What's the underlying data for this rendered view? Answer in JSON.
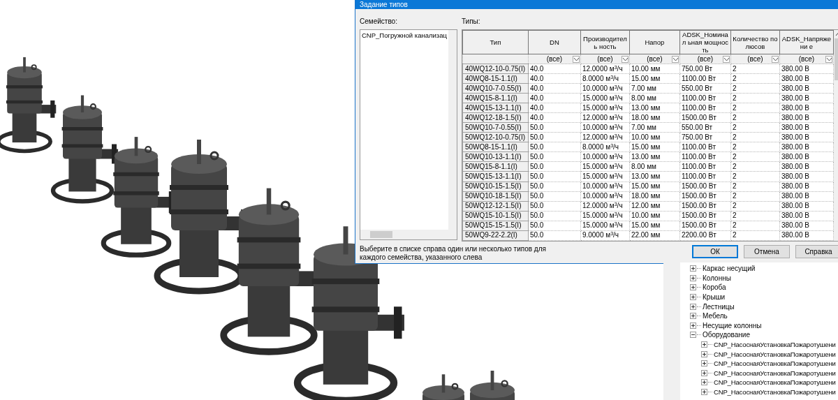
{
  "window": {
    "title": "Задание типов"
  },
  "family": {
    "label": "Семейство:",
    "items": [
      {
        "label": "CNP_Погружной канализац"
      }
    ]
  },
  "types": {
    "label": "Типы:",
    "columns": [
      {
        "title": "Тип"
      },
      {
        "title": "DN",
        "filter": "(все)"
      },
      {
        "title": "Производитель ность",
        "filter": "(все)"
      },
      {
        "title": "Напор",
        "filter": "(все)"
      },
      {
        "title": "ADSK_Номинал ьная мощность",
        "filter": "(все)"
      },
      {
        "title": "Количество полюсов",
        "filter": "(все)"
      },
      {
        "title": "ADSK_Напряжени е",
        "filter": "(все)"
      }
    ],
    "rows": [
      [
        "40WQ12-10-0.75(I)",
        "40.0",
        "12.0000 м$^{3}$/ч",
        "10.00 мм",
        "750.00 Вт",
        "2",
        "380.00 В"
      ],
      [
        "40WQ8-15-1.1(I)",
        "40.0",
        "8.0000 м$^{3}$/ч",
        "15.00 мм",
        "1100.00 Вт",
        "2",
        "380.00 В"
      ],
      [
        "40WQ10-7-0.55(I)",
        "40.0",
        "10.0000 м$^{3}$/ч",
        "7.00 мм",
        "550.00 Вт",
        "2",
        "380.00 В"
      ],
      [
        "40WQ15-8-1.1(I)",
        "40.0",
        "15.0000 м$^{3}$/ч",
        "8.00 мм",
        "1100.00 Вт",
        "2",
        "380.00 В"
      ],
      [
        "40WQ15-13-1.1(I)",
        "40.0",
        "15.0000 м$^{3}$/ч",
        "13.00 мм",
        "1100.00 Вт",
        "2",
        "380.00 В"
      ],
      [
        "40WQ12-18-1.5(I)",
        "40.0",
        "12.0000 м$^{3}$/ч",
        "18.00 мм",
        "1500.00 Вт",
        "2",
        "380.00 В"
      ],
      [
        "50WQ10-7-0.55(I)",
        "50.0",
        "10.0000 м$^{3}$/ч",
        "7.00 мм",
        "550.00 Вт",
        "2",
        "380.00 В"
      ],
      [
        "50WQ12-10-0.75(I)",
        "50.0",
        "12.0000 м$^{3}$/ч",
        "10.00 мм",
        "750.00 Вт",
        "2",
        "380.00 В"
      ],
      [
        "50WQ8-15-1.1(I)",
        "50.0",
        "8.0000 м$^{3}$/ч",
        "15.00 мм",
        "1100.00 Вт",
        "2",
        "380.00 В"
      ],
      [
        "50WQ10-13-1.1(I)",
        "50.0",
        "10.0000 м$^{3}$/ч",
        "13.00 мм",
        "1100.00 Вт",
        "2",
        "380.00 В"
      ],
      [
        "50WQ15-8-1.1(I)",
        "50.0",
        "15.0000 м$^{3}$/ч",
        "8.00 мм",
        "1100.00 Вт",
        "2",
        "380.00 В"
      ],
      [
        "50WQ15-13-1.1(I)",
        "50.0",
        "15.0000 м$^{3}$/ч",
        "13.00 мм",
        "1100.00 Вт",
        "2",
        "380.00 В"
      ],
      [
        "50WQ10-15-1.5(I)",
        "50.0",
        "10.0000 м$^{3}$/ч",
        "15.00 мм",
        "1500.00 Вт",
        "2",
        "380.00 В"
      ],
      [
        "50WQ10-18-1.5(I)",
        "50.0",
        "10.0000 м$^{3}$/ч",
        "18.00 мм",
        "1500.00 Вт",
        "2",
        "380.00 В"
      ],
      [
        "50WQ12-12-1.5(I)",
        "50.0",
        "12.0000 м$^{3}$/ч",
        "12.00 мм",
        "1500.00 Вт",
        "2",
        "380.00 В"
      ],
      [
        "50WQ15-10-1.5(I)",
        "50.0",
        "15.0000 м$^{3}$/ч",
        "10.00 мм",
        "1500.00 Вт",
        "2",
        "380.00 В"
      ],
      [
        "50WQ15-15-1.5(I)",
        "50.0",
        "15.0000 м$^{3}$/ч",
        "15.00 мм",
        "1500.00 Вт",
        "2",
        "380.00 В"
      ],
      [
        "50WQ9-22-2.2(I)",
        "50.0",
        "9.0000 м$^{3}$/ч",
        "22.00 мм",
        "2200.00 Вт",
        "2",
        "380.00 В"
      ]
    ]
  },
  "hint": "Выберите в списке справа один или несколько типов для каждого семейства, указанного слева",
  "buttons": [
    {
      "label": "ОК",
      "default": true
    },
    {
      "label": "Отмена",
      "default": false
    },
    {
      "label": "Справка",
      "default": false
    }
  ],
  "project_browser": {
    "items": [
      {
        "label": "Каркас несущий",
        "expanded": false
      },
      {
        "label": "Колонны",
        "expanded": false
      },
      {
        "label": "Короба",
        "expanded": false
      },
      {
        "label": "Крыши",
        "expanded": false
      },
      {
        "label": "Лестницы",
        "expanded": false
      },
      {
        "label": "Мебель",
        "expanded": false
      },
      {
        "label": "Несущие колонны",
        "expanded": false
      },
      {
        "label": "Оборудование",
        "expanded": true,
        "children": [
          {
            "label": "CNP_НасоснаяУстановкаПожаротушени",
            "expanded": false
          },
          {
            "label": "CNP_НасоснаяУстановкаПожаротушени",
            "expanded": false
          },
          {
            "label": "CNP_НасоснаяУстановкаПожаротушени",
            "expanded": false
          },
          {
            "label": "CNP_НасоснаяУстановкаПожаротушени",
            "expanded": false
          },
          {
            "label": "CNP_НасоснаяУстановкаПожаротушени",
            "expanded": false
          },
          {
            "label": "CNP_НасоснаяУстановкаПожаротушени",
            "expanded": false
          }
        ]
      }
    ]
  }
}
